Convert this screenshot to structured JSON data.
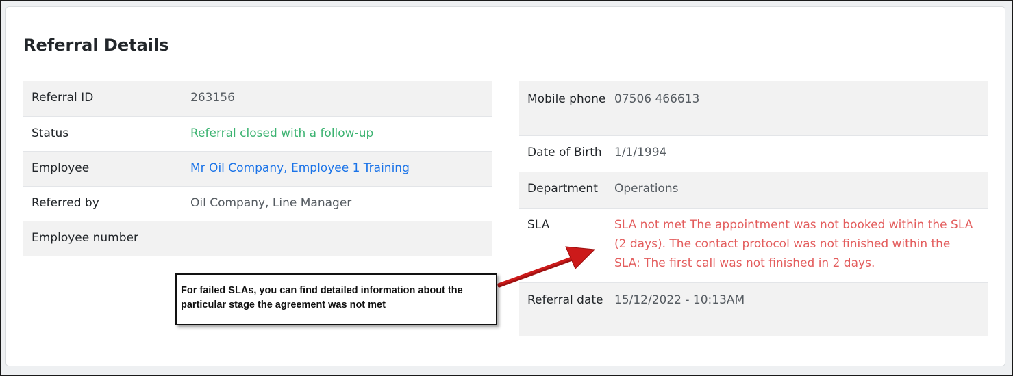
{
  "page": {
    "title": "Referral Details"
  },
  "left_details": [
    {
      "label": "Referral ID",
      "value": "263156"
    },
    {
      "label": "Status",
      "value": "Referral closed with a follow-up"
    },
    {
      "label": "Employee",
      "value": "Mr Oil Company, Employee 1 Training"
    },
    {
      "label": "Referred by",
      "value": "Oil Company, Line Manager"
    },
    {
      "label": "Employee number",
      "value": ""
    }
  ],
  "right_details": [
    {
      "label": "Mobile phone",
      "value": "07506 466613"
    },
    {
      "label": "Date of Birth",
      "value": "1/1/1994"
    },
    {
      "label": "Department",
      "value": "Operations"
    },
    {
      "label": "SLA",
      "value": "SLA not met The appointment was not booked within the SLA (2 days). The contact protocol was not finished within the SLA: The first call was not finished in 2 days."
    },
    {
      "label": "Referral date",
      "value": "15/12/2022 - 10:13AM"
    }
  ],
  "callout": {
    "text": "For failed SLAs, you can find detailed information about the particular stage the agreement was not met"
  },
  "colors": {
    "status_green": "#3cb371",
    "link_blue": "#1a73e8",
    "sla_red": "#e35d5d",
    "arrow_red": "#cc1a1a",
    "row_stripe": "#f2f2f2"
  }
}
